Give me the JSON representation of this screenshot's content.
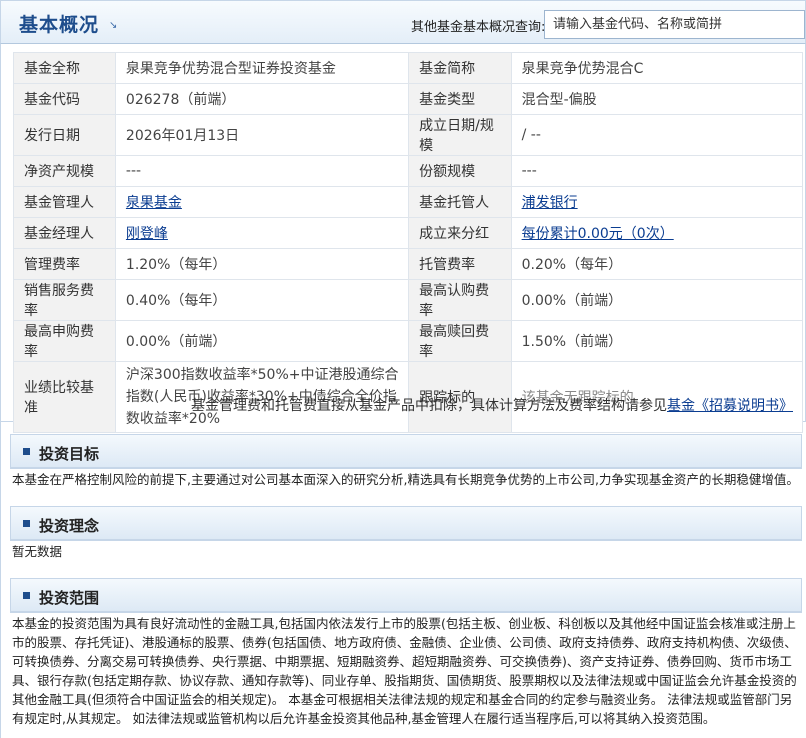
{
  "header": {
    "title": "基本概况",
    "arrow": "↘",
    "query_label": "其他基金基本概况查询:",
    "search_placeholder": "请输入基金代码、名称或简拼"
  },
  "info": {
    "rows": [
      {
        "l1": "基金全称",
        "v1": "泉果竞争优势混合型证券投资基金",
        "l2": "基金简称",
        "v2": "泉果竞争优势混合C"
      },
      {
        "l1": "基金代码",
        "v1": "026278（前端）",
        "l2": "基金类型",
        "v2": "混合型-偏股"
      },
      {
        "l1": "发行日期",
        "v1": "2026年01月13日",
        "l2": "成立日期/规模",
        "v2": "/ --"
      },
      {
        "l1": "净资产规模",
        "v1": "---",
        "l2": "份额规模",
        "v2": "---"
      },
      {
        "l1": "基金管理人",
        "v1": "泉果基金",
        "l2": "基金托管人",
        "v2": "浦发银行"
      },
      {
        "l1": "基金经理人",
        "v1": "刚登峰",
        "l2": "成立来分红",
        "v2": "每份累计0.00元（0次）"
      },
      {
        "l1": "管理费率",
        "v1": "1.20%（每年）",
        "l2": "托管费率",
        "v2": "0.20%（每年）"
      },
      {
        "l1": "销售服务费率",
        "v1": "0.40%（每年）",
        "l2": "最高认购费率",
        "v2": "0.00%（前端）"
      },
      {
        "l1": "最高申购费率",
        "v1": "0.00%（前端）",
        "l2": "最高赎回费率",
        "v2": "1.50%（前端）"
      },
      {
        "l1": "业绩比较基准",
        "v1": "沪深300指数收益率*50%+中证港股通综合指数(人民币)收益率*30%+中债综合全价指数收益率*20%",
        "l2": "跟踪标的",
        "v2": "该基金无跟踪标的"
      }
    ],
    "note_text": "基金管理费和托管费直接从基金产品中扣除，具体计算方法及费率结构请参见",
    "note_link": "基金《招募说明书》"
  },
  "sections": {
    "objective": {
      "title": "投资目标",
      "text": "本基金在严格控制风险的前提下,主要通过对公司基本面深入的研究分析,精选具有长期竞争优势的上市公司,力争实现基金资产的长期稳健增值。"
    },
    "philosophy": {
      "title": "投资理念",
      "text": "暂无数据"
    },
    "scope": {
      "title": "投资范围",
      "text": "本基金的投资范围为具有良好流动性的金融工具,包括国内依法发行上市的股票(包括主板、创业板、科创板以及其他经中国证监会核准或注册上市的股票、存托凭证)、港股通标的股票、债券(包括国债、地方政府债、金融债、企业债、公司债、政府支持债券、政府支持机构债、次级债、可转换债券、分离交易可转换债券、央行票据、中期票据、短期融资券、超短期融资券、可交换债券)、资产支持证券、债券回购、货币市场工具、银行存款(包括定期存款、协议存款、通知存款等)、同业存单、股指期货、国债期货、股票期权以及法律法规或中国证监会允许基金投资的其他金融工具(但须符合中国证监会的相关规定)。 本基金可根据相关法律法规的规定和基金合同的约定参与融资业务。 法律法规或监管部门另有规定时,从其规定。 如法律法规或监管机构以后允许基金投资其他品种,基金管理人在履行适当程序后,可以将其纳入投资范围。"
    }
  }
}
